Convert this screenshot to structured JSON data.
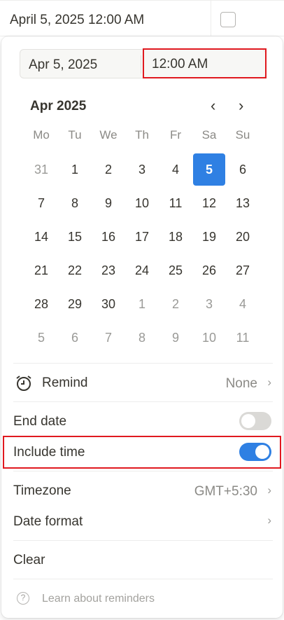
{
  "cell": {
    "value": "April 5, 2025 12:00 AM",
    "checked": false
  },
  "picker": {
    "date_value": "Apr 5, 2025",
    "time_value": "12:00 AM",
    "month_label": "Apr 2025",
    "prev_icon": "chevron-left-icon",
    "next_icon": "chevron-right-icon",
    "weekdays": [
      "Mo",
      "Tu",
      "We",
      "Th",
      "Fr",
      "Sa",
      "Su"
    ],
    "weeks": [
      [
        {
          "d": "31",
          "o": true
        },
        {
          "d": "1"
        },
        {
          "d": "2"
        },
        {
          "d": "3"
        },
        {
          "d": "4"
        },
        {
          "d": "5",
          "sel": true
        },
        {
          "d": "6"
        }
      ],
      [
        {
          "d": "7"
        },
        {
          "d": "8"
        },
        {
          "d": "9"
        },
        {
          "d": "10"
        },
        {
          "d": "11"
        },
        {
          "d": "12"
        },
        {
          "d": "13"
        }
      ],
      [
        {
          "d": "14"
        },
        {
          "d": "15"
        },
        {
          "d": "16"
        },
        {
          "d": "17"
        },
        {
          "d": "18"
        },
        {
          "d": "19"
        },
        {
          "d": "20"
        }
      ],
      [
        {
          "d": "21"
        },
        {
          "d": "22"
        },
        {
          "d": "23"
        },
        {
          "d": "24"
        },
        {
          "d": "25"
        },
        {
          "d": "26"
        },
        {
          "d": "27"
        }
      ],
      [
        {
          "d": "28"
        },
        {
          "d": "29"
        },
        {
          "d": "30"
        },
        {
          "d": "1",
          "o": true
        },
        {
          "d": "2",
          "o": true
        },
        {
          "d": "3",
          "o": true
        },
        {
          "d": "4",
          "o": true
        }
      ],
      [
        {
          "d": "5",
          "o": true
        },
        {
          "d": "6",
          "o": true
        },
        {
          "d": "7",
          "o": true
        },
        {
          "d": "8",
          "o": true
        },
        {
          "d": "9",
          "o": true
        },
        {
          "d": "10",
          "o": true
        },
        {
          "d": "11",
          "o": true
        }
      ]
    ],
    "selected_color": "#2f80e3"
  },
  "options": {
    "remind_label": "Remind",
    "remind_value": "None",
    "end_date_label": "End date",
    "end_date_on": false,
    "include_time_label": "Include time",
    "include_time_on": true,
    "timezone_label": "Timezone",
    "timezone_value": "GMT+5:30",
    "date_format_label": "Date format",
    "clear_label": "Clear",
    "learn_label": "Learn about reminders",
    "toggle_on_color": "#2f80e3",
    "toggle_off_color": "#dad9d6",
    "highlight_color": "#e0191f"
  }
}
